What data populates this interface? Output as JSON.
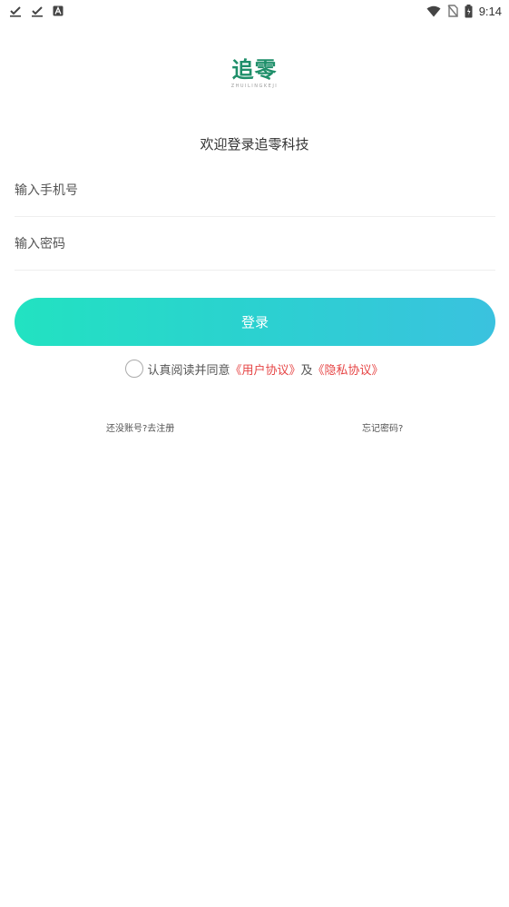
{
  "status_bar": {
    "time": "9:14",
    "left_icons": [
      "check-download-icon",
      "check-download-icon",
      "a-notification-icon"
    ],
    "right_icons": [
      "wifi-icon",
      "no-sim-icon",
      "battery-icon"
    ]
  },
  "logo": {
    "text": "追零",
    "subtitle": "ZHUILINGKEJI",
    "color": "#1f8f6a"
  },
  "welcome": "欢迎登录追零科技",
  "form": {
    "phone_placeholder": "输入手机号",
    "password_placeholder": "输入密码"
  },
  "login_button": {
    "label": "登录",
    "gradient_start": "#22e2c1",
    "gradient_end": "#3ac2df"
  },
  "agreement": {
    "prefix": "认真阅读并同意",
    "user_agreement": "《用户协议》",
    "conjunction": "及",
    "privacy_policy": "《隐私协议》",
    "link_color": "#e64545"
  },
  "links": {
    "register": "还没账号?去注册",
    "forgot": "忘记密码?"
  }
}
